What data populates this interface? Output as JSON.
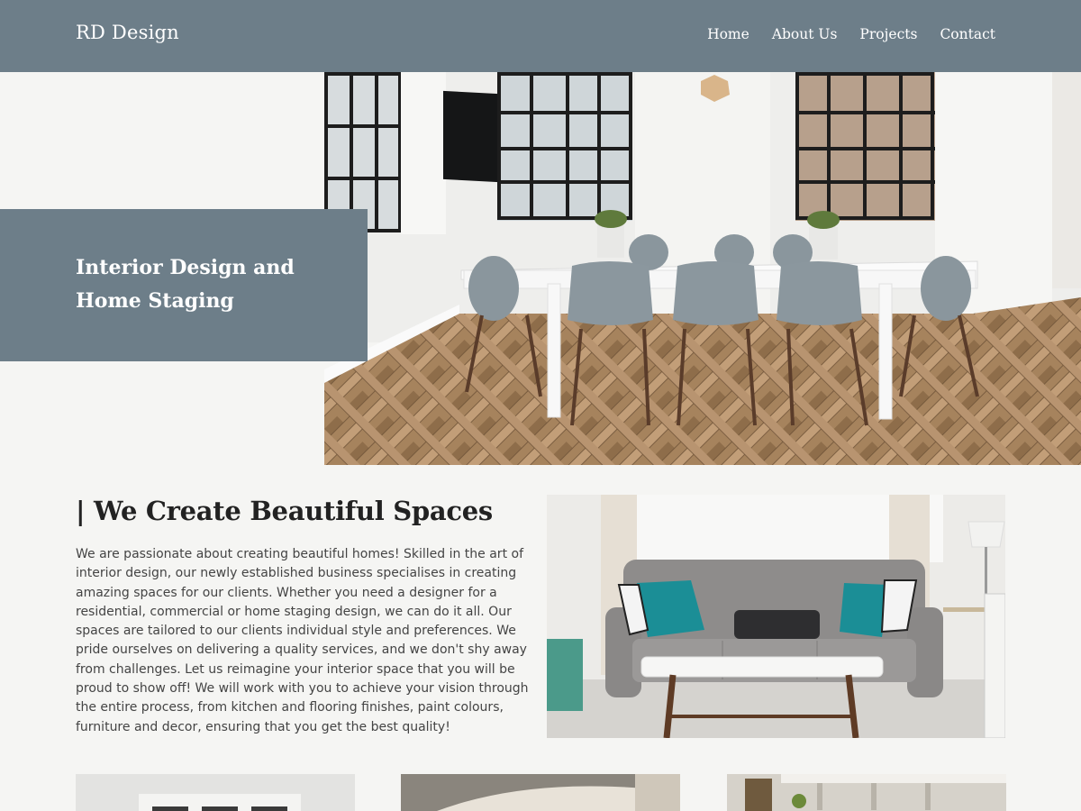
{
  "header": {
    "brand": "RD Design",
    "nav": [
      "Home",
      "About Us",
      "Projects",
      "Contact"
    ]
  },
  "hero": {
    "title": "Interior Design and Home Staging"
  },
  "about": {
    "heading": "| We Create Beautiful Spaces",
    "body": "We are passionate about creating beautiful homes! Skilled in the art of interior design, our newly established business specialises in creating amazing spaces for our clients. Whether you need a designer for a residential, commercial or home staging design, we can do it all. Our spaces are tailored to our clients individual style and preferences. We pride ourselves on delivering a quality services, and we don't shy away from challenges. Let us reimagine your interior space that you will be proud to show off! We will work with you to achieve your vision through the entire process, from kitchen and flooring finishes, paint colours, furniture and decor, ensuring that you get the best quality!"
  },
  "colors": {
    "header_bg": "#6d7e89",
    "page_bg": "#f5f5f3",
    "heading_text": "#222222",
    "body_text": "#444444"
  },
  "icons": [
    "dining-room-photo",
    "living-room-photo",
    "project-thumbnail-photo"
  ]
}
